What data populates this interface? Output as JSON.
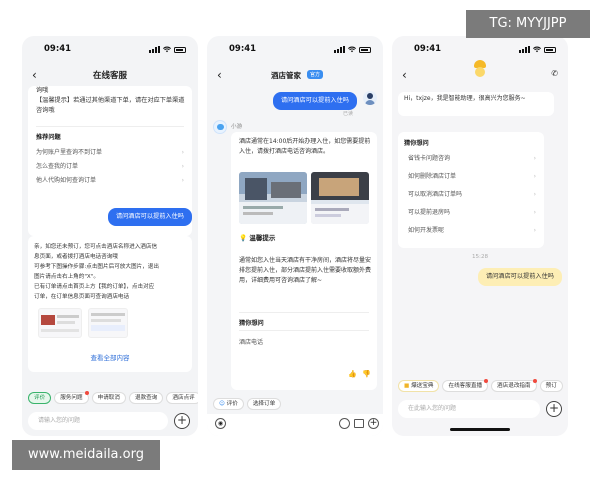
{
  "phone1": {
    "time": "09:41",
    "title": "在线客服",
    "top_snippet": "询哦",
    "tip_text": "【温馨提示】若通过其他渠道下单，请在对应下单渠道咨询哦",
    "faq_title": "推荐问题",
    "faq_items": [
      "为何账户里查询不到订单",
      "怎么查我的订单",
      "他人代购如何查询订单"
    ],
    "user_msg": "请问酒店可以提前入住吗",
    "reply_lines": [
      "亲，如您还未预订，您可点击酒店名称进入酒店信",
      "息页面，或者拨打酒店电话咨询哦",
      "可参考下图操作步骤:点击图片后可放大图片，退出",
      "图片请点击右上角的\"X\"。",
      "已有订单请点击首页上方【我的订单】，点击对应",
      "订单，在订单信息页面可查询酒店电话"
    ],
    "view_all": "查看全部内容",
    "chips": [
      "评价",
      "服务问题",
      "申请取消",
      "退款查询",
      "酒店点评"
    ],
    "input_placeholder": "请输入您的问题"
  },
  "phone2": {
    "time": "09:41",
    "title": "酒店管家",
    "title_badge": "官方",
    "user_msg": "请问酒店可以提前入住吗",
    "read_label": "已读",
    "bot_name": "小游",
    "reply_text": "酒店通常在14:00后开始办理入住，如您需要提前入住，请拨打酒店电话咨询酒店。",
    "tip_title": "温馨提示",
    "tip_body": "通常如您入住当天酒店有干净房间，酒店将尽量安排您提前入住，部分酒店提前入住需要收取额外费用，详细费用可咨询酒店了解~",
    "guess_title": "猜你想问",
    "guess_item": "酒店电话",
    "chips": [
      "评价",
      "选择订单"
    ]
  },
  "phone3": {
    "time": "09:41",
    "greeting": "Hi，txjze，我是智能助理，很高兴为您服务~",
    "guess_title": "猜你想问",
    "faq_items": [
      "省钱卡问题咨询",
      "如何删除酒店订单",
      "可以取消酒店订单吗",
      "可以提前退房吗",
      "如何开发票呢"
    ],
    "timestamp": "15:28",
    "user_msg": "请问酒店可以提前入住吗",
    "chips": [
      "爆送宝典",
      "在线客服直播",
      "酒店退改指南",
      "预订"
    ],
    "input_placeholder": "在此输入您的问题"
  },
  "watermarks": {
    "top_right": "TG: MYYJJPP",
    "bottom_left": "www.meidaila.org"
  },
  "colors": {
    "blue": "#2e6ff0",
    "green": "#39b36b",
    "yellow": "#fdeeb5",
    "red_dot": "#f04a3e"
  }
}
